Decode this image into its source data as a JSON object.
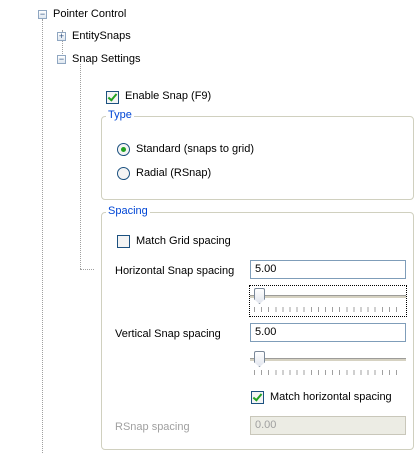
{
  "tree": {
    "root_label": "Pointer Control",
    "children": [
      {
        "label": "EntitySnaps",
        "expander": "+"
      },
      {
        "label": "Snap Settings",
        "expander": "−"
      }
    ],
    "root_expander": "−"
  },
  "snap": {
    "enable_label": "Enable Snap (F9)",
    "enable_checked": true,
    "type": {
      "legend": "Type",
      "options": [
        {
          "label": "Standard (snaps to grid)",
          "selected": true
        },
        {
          "label": "Radial (RSnap)",
          "selected": false
        }
      ]
    },
    "spacing": {
      "legend": "Spacing",
      "match_grid_label": "Match Grid spacing",
      "match_grid_checked": false,
      "horizontal_label": "Horizontal Snap spacing",
      "horizontal_value": "5.00",
      "horizontal_slider_level": 0.0,
      "vertical_label": "Vertical Snap spacing",
      "vertical_value": "5.00",
      "vertical_slider_level": 0.0,
      "match_horizontal_label": "Match horizontal spacing",
      "match_horizontal_checked": true,
      "rsnap_label": "RSnap spacing",
      "rsnap_value": "0.00"
    }
  },
  "colors": {
    "legend_text": "#0046d5",
    "check_mark": "#21a121",
    "field_border": "#7f9db9"
  }
}
